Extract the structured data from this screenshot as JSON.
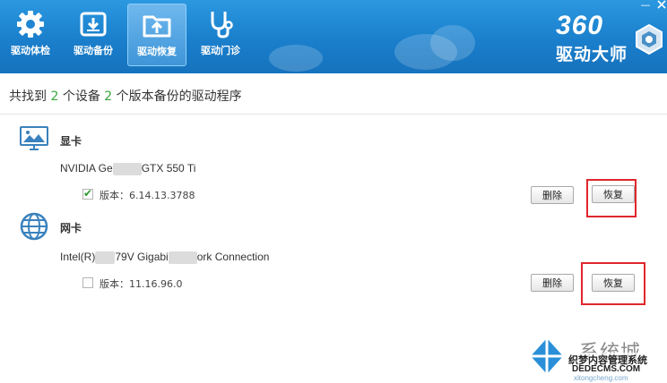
{
  "window": {
    "minimize_label": "—"
  },
  "nav": [
    {
      "label": "驱动体检",
      "icon": "gear-icon"
    },
    {
      "label": "驱动备份",
      "icon": "download-box-icon"
    },
    {
      "label": "驱动恢复",
      "icon": "upload-folder-icon",
      "active": true
    },
    {
      "label": "驱动门诊",
      "icon": "stethoscope-icon"
    }
  ],
  "logo": {
    "number": "360",
    "name": "驱动大师"
  },
  "summary": {
    "prefix": "共找到",
    "devices": "2",
    "mid": "个设备",
    "versions": "2",
    "suffix": "个版本备份的驱动程序"
  },
  "categories": [
    {
      "title": "显卡",
      "icon": "monitor-icon",
      "device_prefix": "NVIDIA Ge",
      "device_suffix": "GTX 550 Ti",
      "checked": true,
      "version": "版本：6.14.13.3788",
      "delete_label": "删除",
      "restore_label": "恢复"
    },
    {
      "title": "网卡",
      "icon": "globe-icon",
      "device_prefix": "Intel(R)",
      "device_mid": "79V Gigabi",
      "device_suffix": "ork Connection",
      "checked": false,
      "version": "版本：11.16.96.0",
      "delete_label": "删除",
      "restore_label": "恢复"
    }
  ],
  "watermark": {
    "brand": "系统城",
    "line1": "织梦内容管理系统",
    "line2": "DEDECMS.COM",
    "line3": "xitongcheng.com"
  },
  "colors": {
    "topbar": "#1a7fcc",
    "accent_number": "#39a63c",
    "highlight": "#e0262c"
  }
}
